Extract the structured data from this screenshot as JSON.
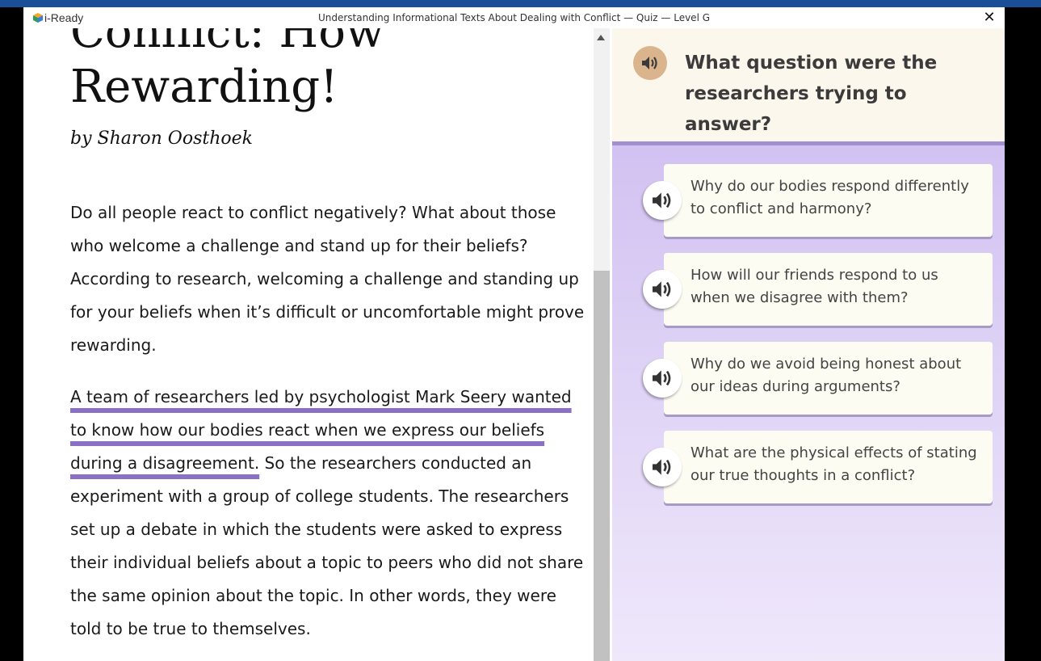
{
  "header": {
    "logo_text": "i-Ready",
    "title": "Understanding Informational Texts About Dealing with Conflict — Quiz — Level G",
    "close_symbol": "✕"
  },
  "article": {
    "title_partial": "Conflict: How",
    "title_main": "Rewarding!",
    "byline": "by Sharon Oosthoek",
    "para1": "Do all people react to conflict negatively? What about those who welcome a challenge and stand up for their beliefs? According to research, welcoming a challenge and standing up for your beliefs when it’s difficult or uncomfortable might prove rewarding.",
    "para2_highlight": "A team of researchers led by psychologist Mark Seery wanted to know how our bodies react when we express our beliefs during a disagreement.",
    "para2_rest": " So the researchers conducted an experiment with a group of college students. The researchers set up a debate in which the students were asked to express their individual beliefs about a topic to peers who did not share the same opinion about the topic. In other words, they were told to be true to themselves."
  },
  "question": {
    "text": "What question were the researchers trying to answer?",
    "choices": [
      {
        "label": "Why do our bodies respond differently to conflict and harmony?"
      },
      {
        "label": "How will our friends respond to us when we disagree with them?"
      },
      {
        "label": "Why do we avoid being honest about our ideas during arguments?"
      },
      {
        "label": "What are the physical effects of stating our true thoughts in a conflict?"
      }
    ]
  },
  "colors": {
    "topbar": "#1a4f98",
    "highlight": "#8a71c6",
    "panel_top": "#cbb9ef",
    "question_bg": "#fcf7ec",
    "speaker_accent": "#d9b48c"
  },
  "icons": {
    "question_audio": "speaker-icon",
    "choice_audio": "speaker-icon",
    "close": "close-icon",
    "scroll": "scroll-up-arrow-icon"
  }
}
